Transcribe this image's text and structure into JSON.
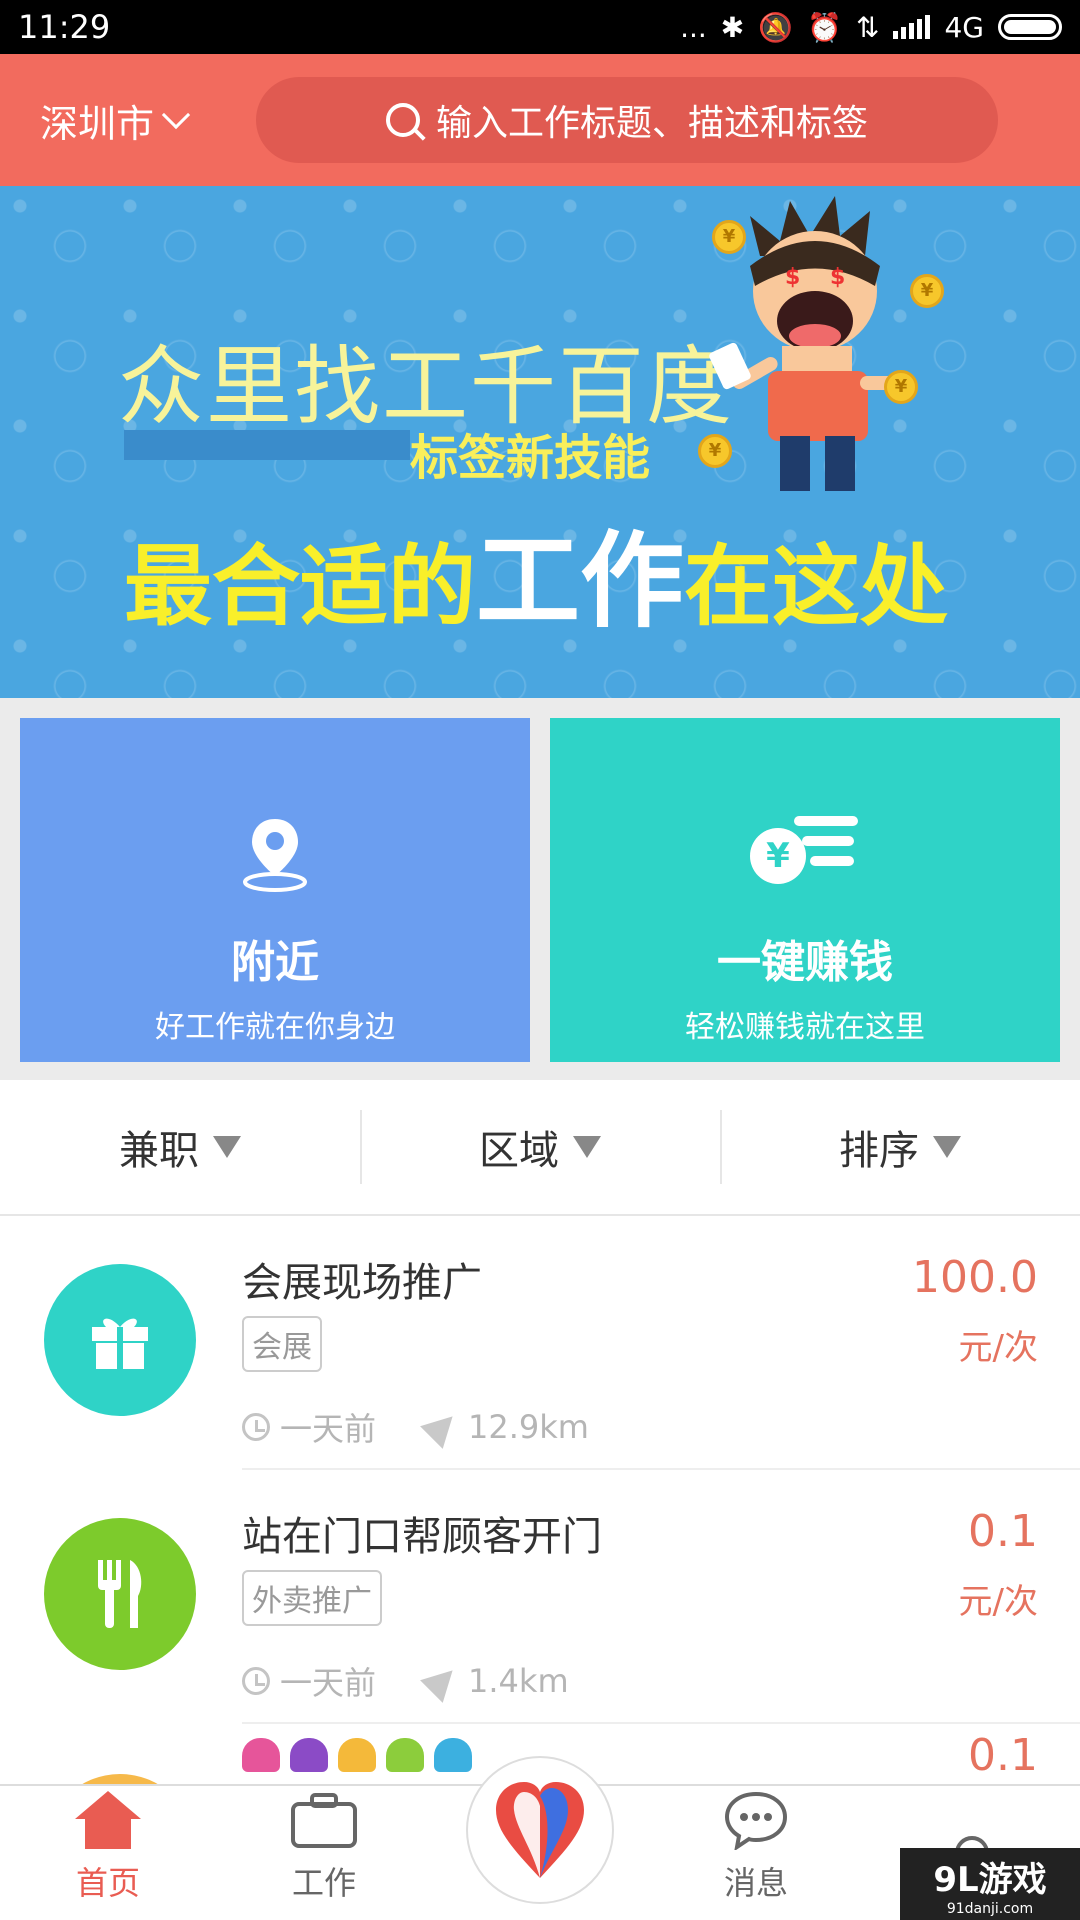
{
  "status_bar": {
    "time": "11:29",
    "network": "4G",
    "dots": "..."
  },
  "header": {
    "city": "深圳市",
    "search_placeholder": "输入工作标题、描述和标签"
  },
  "banner": {
    "line1": "众里找工千百度",
    "line2": "标签新技能",
    "line3_a": "最合适的",
    "line3_b": "工作",
    "line3_c": "在这处",
    "coin_symbol": "¥"
  },
  "cards": [
    {
      "title": "附近",
      "subtitle": "好工作就在你身边",
      "icon": "location-pin-icon",
      "color": "#6b9ef0"
    },
    {
      "title": "一键赚钱",
      "subtitle": "轻松赚钱就在这里",
      "icon": "yen-coin-icon",
      "color": "#2fd3c7",
      "coin_symbol": "¥"
    }
  ],
  "filters": [
    {
      "label": "兼职"
    },
    {
      "label": "区域"
    },
    {
      "label": "排序"
    }
  ],
  "jobs": [
    {
      "title": "会展现场推广",
      "tag": "会展",
      "time": "一天前",
      "distance": "12.9km",
      "price": "100.0",
      "unit": "元/次",
      "icon": "gift-icon",
      "color": "#2fd3c7"
    },
    {
      "title": "站在门口帮顾客开门",
      "tag": "外卖推广",
      "time": "一天前",
      "distance": "1.4km",
      "price": "0.1",
      "unit": "元/次",
      "icon": "fork-knife-icon",
      "color": "#7dcb2c"
    },
    {
      "price": "0.1",
      "color": "#f6b94a"
    }
  ],
  "nav": [
    {
      "label": "首页",
      "icon": "home-icon",
      "active": true
    },
    {
      "label": "工作",
      "icon": "briefcase-icon",
      "active": false
    },
    {
      "label": "",
      "icon": "app-logo-icon",
      "active": false
    },
    {
      "label": "消息",
      "icon": "chat-bubble-icon",
      "active": false
    },
    {
      "label": "",
      "icon": "user-icon",
      "active": false
    }
  ],
  "watermark": {
    "brand": "9L游戏",
    "url": "91danji.com"
  },
  "colors": {
    "header": "#f26b5e",
    "banner": "#4aa6e0",
    "price": "#e5735f",
    "active_nav": "#e95c52"
  }
}
